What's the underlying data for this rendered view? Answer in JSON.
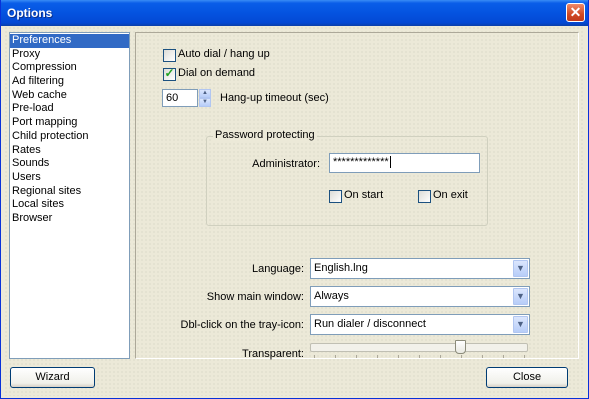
{
  "window": {
    "title": "Options",
    "close_glyph": "✕"
  },
  "sidebar": {
    "items": [
      {
        "label": "Preferences",
        "selected": true
      },
      {
        "label": "Proxy"
      },
      {
        "label": "Compression"
      },
      {
        "label": "Ad filtering"
      },
      {
        "label": "Web cache"
      },
      {
        "label": "Pre-load"
      },
      {
        "label": "Port mapping"
      },
      {
        "label": "Child protection"
      },
      {
        "label": "Rates"
      },
      {
        "label": "Sounds"
      },
      {
        "label": "Users"
      },
      {
        "label": "Regional sites"
      },
      {
        "label": "Local sites"
      },
      {
        "label": "Browser"
      }
    ]
  },
  "preferences": {
    "auto_dial": {
      "label": "Auto dial / hang up",
      "checked": false
    },
    "dial_on_demand": {
      "label": "Dial on demand",
      "checked": true
    },
    "hangup_timeout": {
      "value": "60",
      "label": "Hang-up timeout (sec)"
    },
    "password_group": {
      "legend": "Password protecting",
      "admin_label": "Administrator:",
      "admin_value": "*************",
      "on_start": {
        "label": "On start",
        "checked": false
      },
      "on_exit": {
        "label": "On exit",
        "checked": false
      }
    },
    "language": {
      "label": "Language:",
      "value": "English.lng"
    },
    "main_window": {
      "label": "Show main window:",
      "value": "Always"
    },
    "tray_click": {
      "label": "Dbl-click on the tray-icon:",
      "value": "Run dialer / disconnect"
    },
    "transparent": {
      "label": "Transparent:",
      "level": 0.7
    }
  },
  "footer": {
    "wizard_label": "Wizard",
    "close_label": "Close"
  },
  "colors": {
    "accent": "#316ac5",
    "title_bar": "#0453e0",
    "check_mark": "#21a121"
  }
}
